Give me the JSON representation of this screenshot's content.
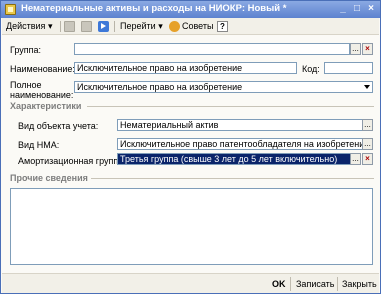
{
  "window": {
    "title": "Нематериальные активы и расходы на НИОКР: Новый *",
    "minimize": "_",
    "maximize": "□",
    "close": "×"
  },
  "toolbar": {
    "actions": "Действия",
    "goto": "Перейти",
    "tips": "Советы",
    "help": "?"
  },
  "form": {
    "group_label": "Группа:",
    "group_value": "",
    "name_label": "Наименование:",
    "name_value": "Исключительное право на изобретение",
    "code_label": "Код:",
    "code_value": "",
    "full_name_label_1": "Полное",
    "full_name_label_2": "наименование:",
    "full_name_value": "Исключительное право на изобретение"
  },
  "characteristics": {
    "title": "Характеристики",
    "object_type_label": "Вид объекта учета:",
    "object_type_value": "Нематериальный актив",
    "nma_type_label": "Вид НМА:",
    "nma_type_value": "Исключительное право патентообладателя на изобретение,",
    "amort_group_label": "Амортизационная группа:",
    "amort_group_value": "Третья группа (свыше 3 лет до 5 лет включительно)"
  },
  "other": {
    "title": "Прочие сведения",
    "notes": ""
  },
  "buttons": {
    "ok": "OK",
    "save": "Записать",
    "close": "Закрыть"
  },
  "symbols": {
    "dots": "...",
    "clear": "×"
  }
}
